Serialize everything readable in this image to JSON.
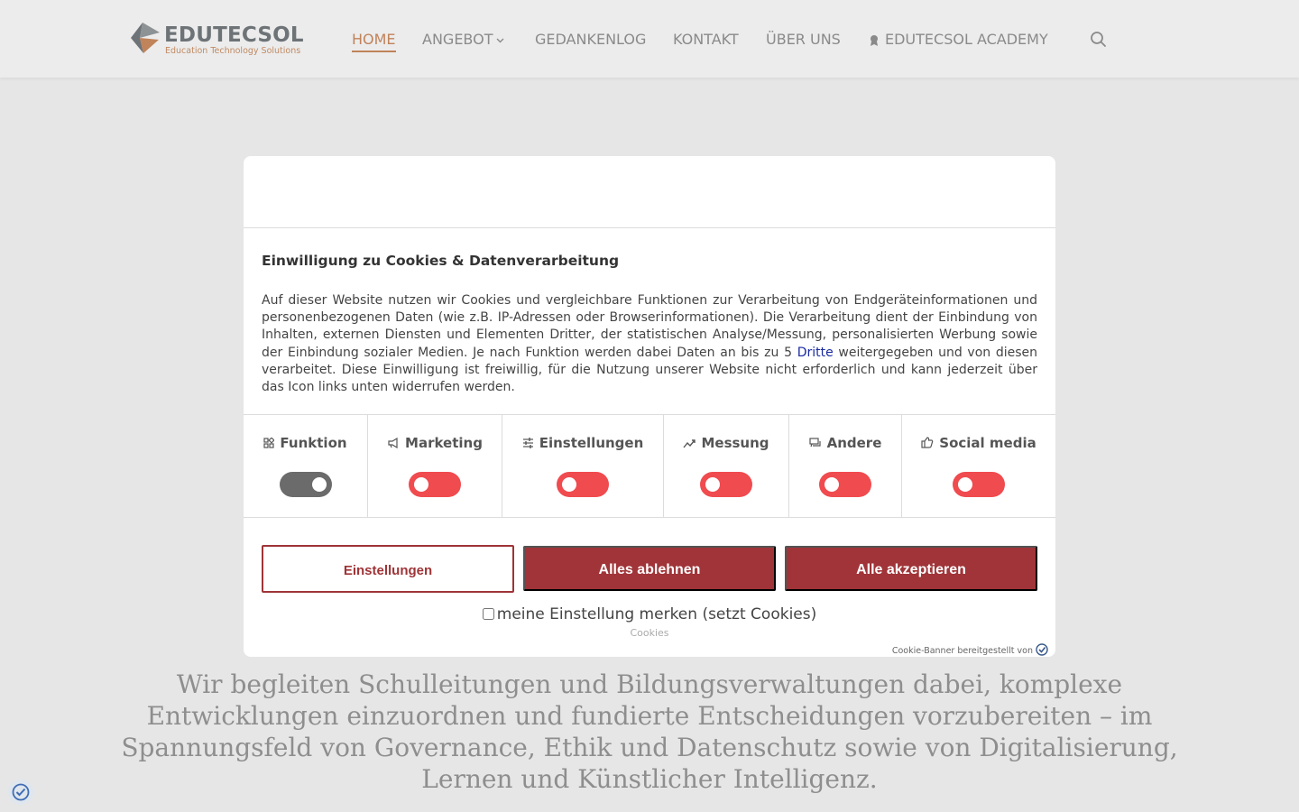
{
  "brand": {
    "name": "EDUTECSOL",
    "tagline": "Education Technology Solutions"
  },
  "nav": {
    "items": [
      {
        "label": "HOME"
      },
      {
        "label": "ANGEBOT"
      },
      {
        "label": "GEDANKENLOG"
      },
      {
        "label": "KONTAKT"
      },
      {
        "label": "ÜBER UNS"
      },
      {
        "label": "EDUTECSOL ACADEMY"
      }
    ]
  },
  "hero": {
    "text": "Wir begleiten Schulleitungen und Bildungsverwaltungen dabei, komplexe Entwicklungen einzuordnen und fundierte Entscheidungen vorzubereiten – im Spannungsfeld von Governance, Ethik und Datenschutz sowie von Digitalisierung, Lernen und Künstlicher Intelligenz."
  },
  "consent": {
    "title": "Einwilligung zu Cookies & Datenverarbeitung",
    "text_before_link": "Auf dieser Website nutzen wir Cookies und vergleichbare Funktionen zur Verarbeitung von Endgeräteinformationen und personenbezogenen Daten (wie z.B. IP-Adressen oder Browserinformationen). Die Verarbeitung dient der Einbindung von Inhalten, externen Diensten und Elementen Dritter, der statistischen Analyse/Messung, personalisierten Werbung sowie der Einbindung sozialer Medien. Je nach Funktion werden dabei Daten an bis zu 5 ",
    "link_text": "Dritte",
    "text_after_link": " weitergegeben und von diesen verarbeitet. Diese Einwilligung ist freiwillig, für die Nutzung unserer Website nicht erforderlich und kann jederzeit über das Icon links unten widerrufen werden.",
    "categories": [
      {
        "label": "Funktion",
        "icon": "grid-icon",
        "enabled": true
      },
      {
        "label": "Marketing",
        "icon": "megaphone-icon",
        "enabled": false
      },
      {
        "label": "Einstellungen",
        "icon": "sliders-icon",
        "enabled": false
      },
      {
        "label": "Messung",
        "icon": "trend-icon",
        "enabled": false
      },
      {
        "label": "Andere",
        "icon": "chat-icon",
        "enabled": false
      },
      {
        "label": "Social media",
        "icon": "thumbs-up-icon",
        "enabled": false
      }
    ],
    "settings_label": "Einstellungen",
    "reject_label": "Alles ablehnen",
    "accept_label": "Alle akzeptieren",
    "remember_label": "meine Einstellung merken (setzt Cookies)",
    "cookies_link": "Cookies",
    "powered_by": "Cookie-Banner bereitgestellt von"
  },
  "colors": {
    "accent": "#c0835a",
    "button": "#a03438",
    "toggle_off": "#f04b4f",
    "toggle_on": "#6b6b6b"
  }
}
